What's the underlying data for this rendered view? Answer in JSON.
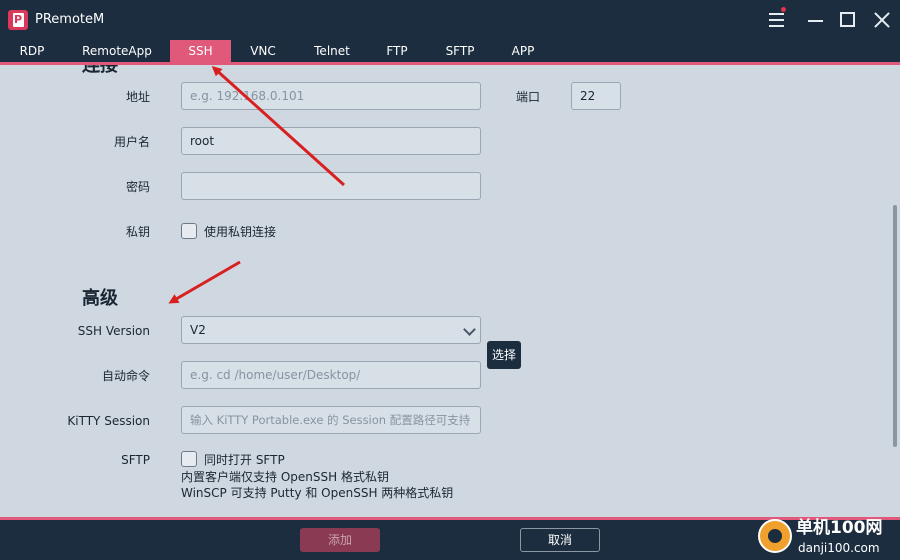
{
  "app": {
    "title": "PRemoteM",
    "logo_letter": "P"
  },
  "window_icons": [
    "menu-icon",
    "minimize-icon",
    "maximize-icon",
    "close-icon"
  ],
  "tabs": [
    {
      "label": "RDP",
      "active": false
    },
    {
      "label": "RemoteApp",
      "active": false
    },
    {
      "label": "SSH",
      "active": true
    },
    {
      "label": "VNC",
      "active": false
    },
    {
      "label": "Telnet",
      "active": false
    },
    {
      "label": "FTP",
      "active": false
    },
    {
      "label": "SFTP",
      "active": false
    },
    {
      "label": "APP",
      "active": false
    }
  ],
  "connection": {
    "section_title": "连接",
    "address": {
      "label": "地址",
      "placeholder": "e.g. 192.168.0.101",
      "value": ""
    },
    "port": {
      "label": "端口",
      "value": "22"
    },
    "username": {
      "label": "用户名",
      "value": "root"
    },
    "password": {
      "label": "密码",
      "value": ""
    },
    "private_key": {
      "label": "私钥",
      "checkbox_label": "使用私钥连接",
      "checked": false
    }
  },
  "advanced": {
    "section_title": "高级",
    "ssh_version": {
      "label": "SSH Version",
      "value": "V2"
    },
    "auto_command": {
      "label": "自动命令",
      "placeholder": "e.g. cd /home/user/Desktop/"
    },
    "kitty_session": {
      "label": "KiTTY Session",
      "placeholder": "输入 KiTTY Portable.exe 的 Session 配置路径可支持",
      "button": "选择"
    },
    "sftp": {
      "label": "SFTP",
      "checkbox_label": "同时打开 SFTP",
      "checked": false,
      "note1": "内置客户端仅支持 OpenSSH 格式私钥",
      "note2": "WinSCP 可支持 Putty 和 OpenSSH 两种格式私钥"
    }
  },
  "footer": {
    "add": "添加",
    "cancel": "取消"
  },
  "watermark": {
    "line1": "单机100网",
    "line2": "danji100.com"
  },
  "colors": {
    "accent": "#e0587a",
    "background": "#1b2d3f",
    "panel": "#cfd8e1",
    "arrow": "#d92020"
  }
}
